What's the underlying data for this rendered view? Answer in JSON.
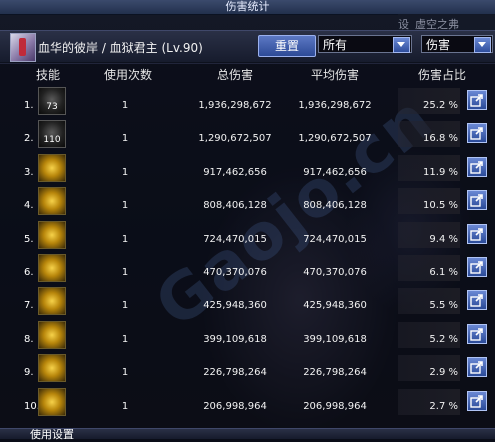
{
  "window": {
    "title": "伤害统计"
  },
  "background": {
    "right_top_text": "虚空之弗",
    "watermark": "Gaojo.cn",
    "overlay_text_1": "血华的彼",
    "overlay_text_2": "设"
  },
  "header": {
    "character": "血华的彼岸 / 血狱君主 (Lv.90)",
    "reset_label": "重置",
    "filter_value": "所有",
    "type_value": "伤害"
  },
  "columns": {
    "skill": "技能",
    "uses": "使用次数",
    "total": "总伤害",
    "avg": "平均伤害",
    "ratio": "伤害占比"
  },
  "rows": [
    {
      "num": "1.",
      "icon": "skill-73-icon",
      "badge": "73",
      "uses": "1",
      "total": "1,936,298,672",
      "avg": "1,936,298,672",
      "pct": "25.2 %",
      "dark": true
    },
    {
      "num": "2.",
      "icon": "skill-110-icon",
      "badge": "110",
      "uses": "1",
      "total": "1,290,672,507",
      "avg": "1,290,672,507",
      "pct": "16.8 %",
      "dark": true
    },
    {
      "num": "3.",
      "icon": "claw-slash-icon",
      "badge": "",
      "uses": "1",
      "total": "917,462,656",
      "avg": "917,462,656",
      "pct": "11.9 %",
      "dark": false
    },
    {
      "num": "4.",
      "icon": "burst-icon",
      "badge": "",
      "uses": "1",
      "total": "808,406,128",
      "avg": "808,406,128",
      "pct": "10.5 %",
      "dark": false
    },
    {
      "num": "5.",
      "icon": "beast-head-icon",
      "badge": "",
      "uses": "1",
      "total": "724,470,015",
      "avg": "724,470,015",
      "pct": "9.4 %",
      "dark": false
    },
    {
      "num": "6.",
      "icon": "dragon-claw-icon",
      "badge": "",
      "uses": "1",
      "total": "470,370,076",
      "avg": "470,370,076",
      "pct": "6.1 %",
      "dark": false
    },
    {
      "num": "7.",
      "icon": "pierce-icon",
      "badge": "",
      "uses": "1",
      "total": "425,948,360",
      "avg": "425,948,360",
      "pct": "5.5 %",
      "dark": false
    },
    {
      "num": "8.",
      "icon": "grab-icon",
      "badge": "",
      "uses": "1",
      "total": "399,109,618",
      "avg": "399,109,618",
      "pct": "5.2 %",
      "dark": false
    },
    {
      "num": "9.",
      "icon": "wave-slash-icon",
      "badge": "",
      "uses": "1",
      "total": "226,798,264",
      "avg": "226,798,264",
      "pct": "2.9 %",
      "dark": false
    },
    {
      "num": "10.",
      "icon": "whirl-icon",
      "badge": "",
      "uses": "1",
      "total": "206,998,964",
      "avg": "206,998,964",
      "pct": "2.7 %",
      "dark": false
    }
  ],
  "footer": {
    "label": "使用设置"
  }
}
